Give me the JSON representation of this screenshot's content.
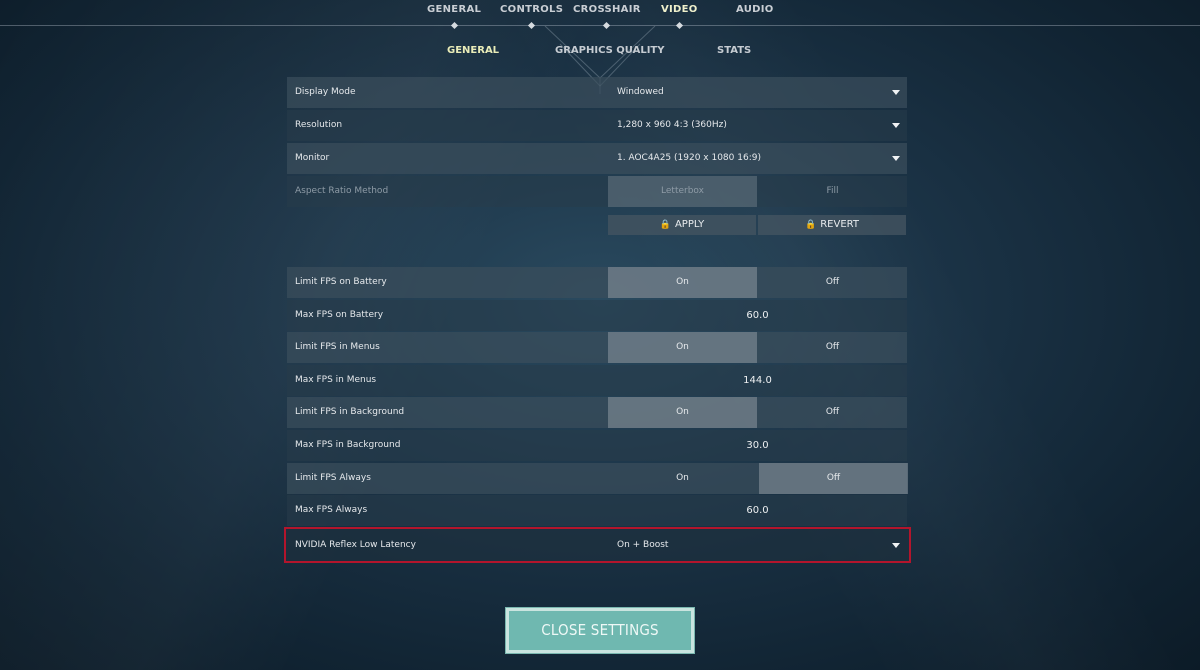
{
  "top_tabs": [
    {
      "label": "GENERAL"
    },
    {
      "label": "CONTROLS"
    },
    {
      "label": "CROSSHAIR"
    },
    {
      "label": "VIDEO"
    },
    {
      "label": "AUDIO"
    }
  ],
  "sub_tabs": [
    {
      "label": "GENERAL"
    },
    {
      "label": "GRAPHICS QUALITY"
    },
    {
      "label": "STATS"
    }
  ],
  "settings": {
    "display_mode": {
      "label": "Display Mode",
      "value": "Windowed"
    },
    "resolution": {
      "label": "Resolution",
      "value": "1,280 x 960 4:3 (360Hz)"
    },
    "monitor": {
      "label": "Monitor",
      "value": "1. AOC4A25 (1920 x  1080 16:9)"
    },
    "aspect_ratio": {
      "label": "Aspect Ratio Method",
      "option_a": "Letterbox",
      "option_b": "Fill",
      "selected": "Letterbox"
    },
    "apply_label": "APPLY",
    "revert_label": "REVERT",
    "limit_fps_battery": {
      "label": "Limit FPS on Battery",
      "on": "On",
      "off": "Off",
      "selected": "On"
    },
    "max_fps_battery": {
      "label": "Max FPS on Battery",
      "value": "60.0"
    },
    "limit_fps_menus": {
      "label": "Limit FPS in Menus",
      "on": "On",
      "off": "Off",
      "selected": "On"
    },
    "max_fps_menus": {
      "label": "Max FPS in Menus",
      "value": "144.0"
    },
    "limit_fps_background": {
      "label": "Limit FPS in Background",
      "on": "On",
      "off": "Off",
      "selected": "On"
    },
    "max_fps_background": {
      "label": "Max FPS in Background",
      "value": "30.0"
    },
    "limit_fps_always": {
      "label": "Limit FPS Always",
      "on": "On",
      "off": "Off",
      "selected": "Off"
    },
    "max_fps_always": {
      "label": "Max FPS Always",
      "value": "60.0"
    },
    "nvidia_reflex": {
      "label": "NVIDIA Reflex Low Latency",
      "value": "On + Boost"
    }
  },
  "close_label": "CLOSE SETTINGS",
  "colors": {
    "highlight_border": "#b3152c",
    "close_button": "#6fb8b0",
    "active_tab": "#eff0cc"
  }
}
